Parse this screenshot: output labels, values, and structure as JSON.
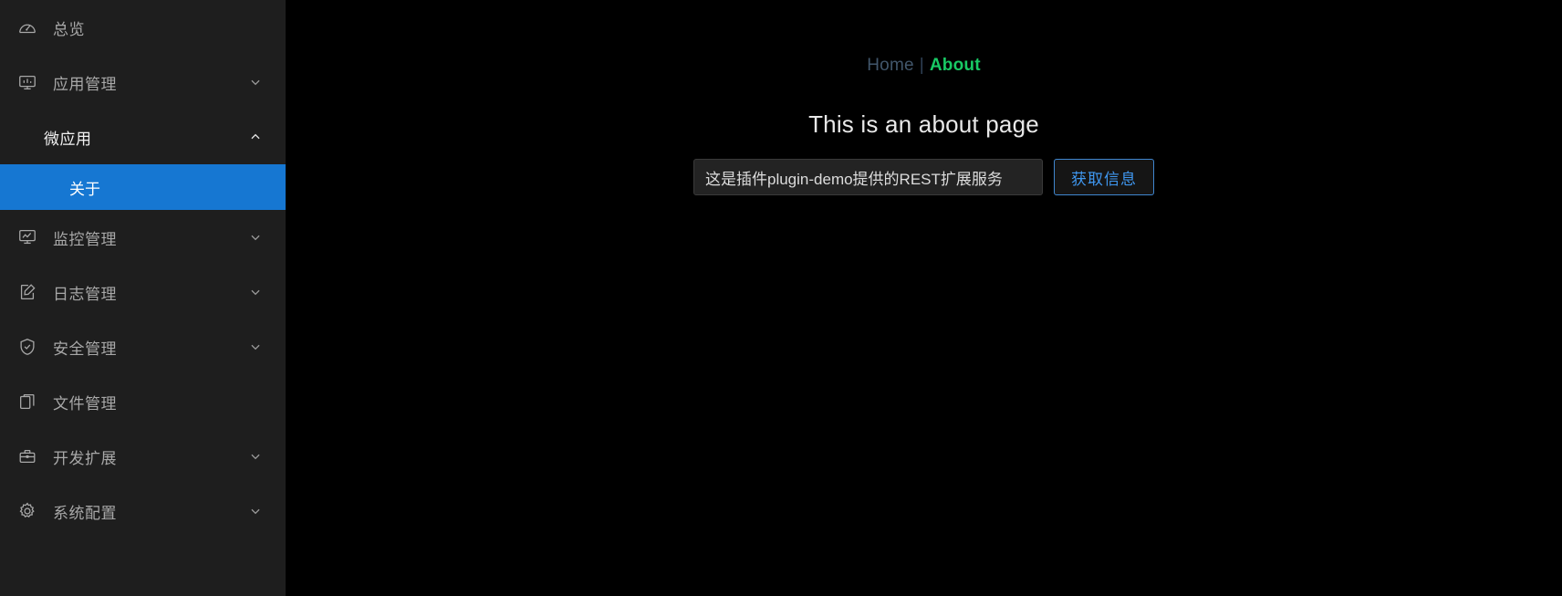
{
  "sidebar": {
    "items": [
      {
        "label": "总览",
        "icon": "gauge-icon",
        "name": "overview",
        "has_chevron": false,
        "expanded": false
      },
      {
        "label": "应用管理",
        "icon": "monitor-icon",
        "name": "app-management",
        "has_chevron": true,
        "expanded": false
      }
    ],
    "submenu": {
      "label": "微应用",
      "name": "micro-app",
      "expanded": true,
      "children": [
        {
          "label": "关于",
          "name": "about",
          "active": true
        }
      ]
    },
    "items_after": [
      {
        "label": "监控管理",
        "icon": "monitor-chart-icon",
        "name": "monitor-management",
        "has_chevron": true
      },
      {
        "label": "日志管理",
        "icon": "edit-note-icon",
        "name": "log-management",
        "has_chevron": true
      },
      {
        "label": "安全管理",
        "icon": "shield-check-icon",
        "name": "security-management",
        "has_chevron": true
      },
      {
        "label": "文件管理",
        "icon": "file-copy-icon",
        "name": "file-management",
        "has_chevron": false
      },
      {
        "label": "开发扩展",
        "icon": "toolbox-icon",
        "name": "dev-extension",
        "has_chevron": true
      },
      {
        "label": "系统配置",
        "icon": "gear-icon",
        "name": "system-config",
        "has_chevron": true
      }
    ]
  },
  "main": {
    "breadcrumb": {
      "home_label": "Home",
      "separator": "|",
      "about_label": "About"
    },
    "page_title": "This is an about page",
    "form": {
      "input_value": "这是插件plugin-demo提供的REST扩展服务",
      "input_placeholder": "",
      "button_label": "获取信息"
    }
  },
  "colors": {
    "sidebar_bg": "#1e1e1e",
    "main_bg": "#000000",
    "active_item": "#1677d2",
    "accent_green": "#18c964",
    "accent_blue": "#3f97f0",
    "muted_text": "#a8a8a8"
  }
}
